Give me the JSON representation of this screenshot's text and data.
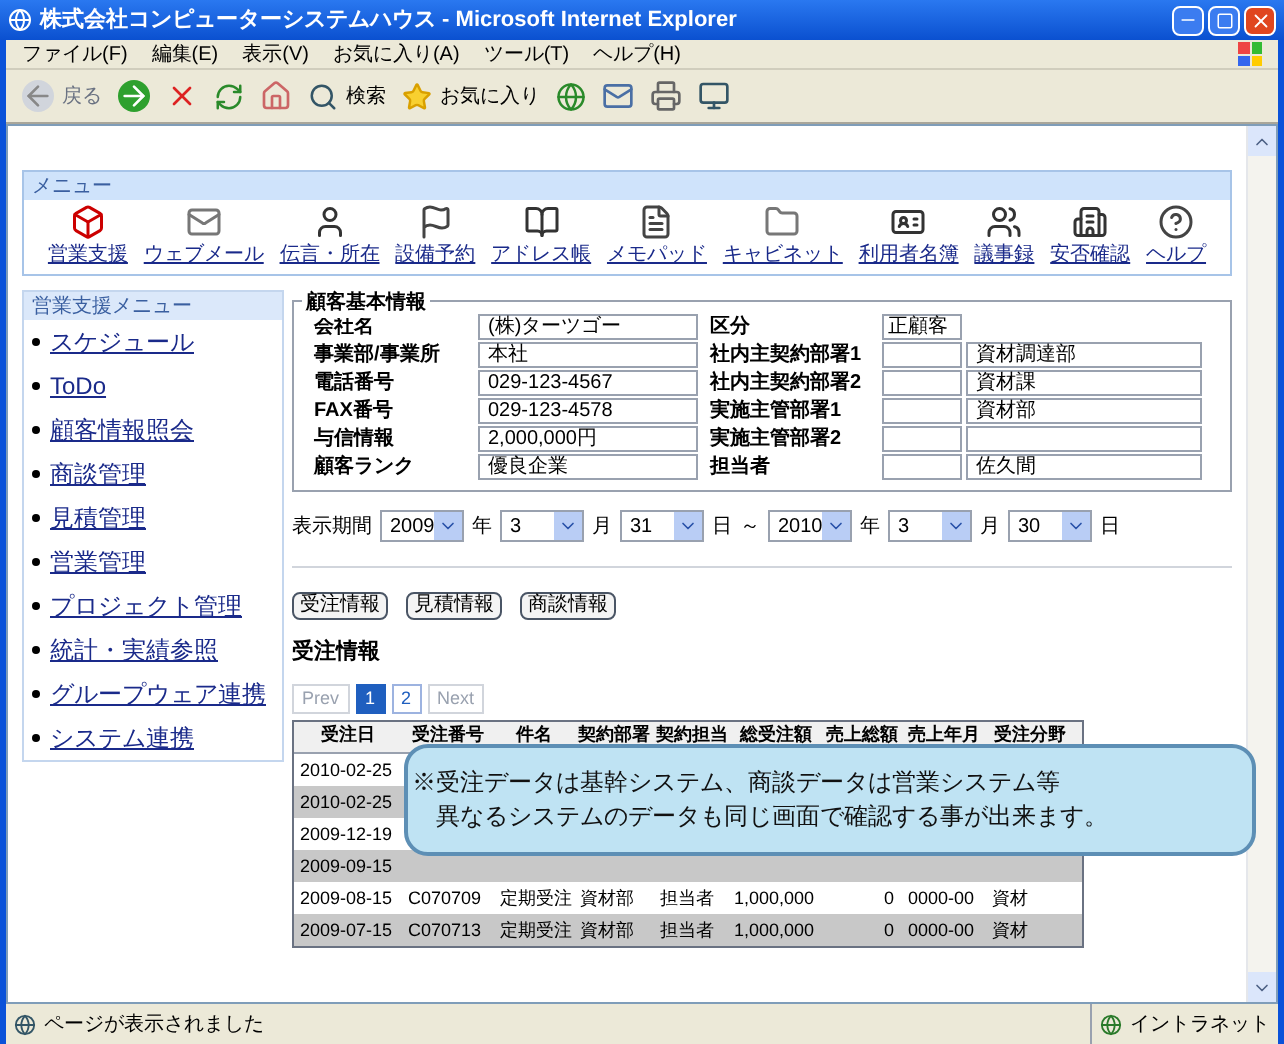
{
  "window": {
    "title": "株式会社コンピューターシステムハウス - Microsoft Internet Explorer"
  },
  "menu_bar": [
    "ファイル(F)",
    "編集(E)",
    "表示(V)",
    "お気に入り(A)",
    "ツール(T)",
    "ヘルプ(H)"
  ],
  "toolbar": {
    "back": "戻る",
    "search": "検索",
    "favorites": "お気に入り"
  },
  "app_menu": {
    "title": "メニュー",
    "items": [
      "営業支援",
      "ウェブメール",
      "伝言・所在",
      "設備予約",
      "アドレス帳",
      "メモパッド",
      "キャビネット",
      "利用者名簿",
      "議事録",
      "安否確認",
      "ヘルプ"
    ]
  },
  "sidebar": {
    "title": "営業支援メニュー",
    "items": [
      "スケジュール",
      "ToDo",
      "顧客情報照会",
      "商談管理",
      "見積管理",
      "営業管理",
      "プロジェクト管理",
      "統計・実績参照",
      "グループウェア連携",
      "システム連携"
    ]
  },
  "customer": {
    "title": "顧客基本情報",
    "rows": [
      {
        "label": "会社名",
        "value": "(株)ターツゴー",
        "label_2": "区分",
        "code": "正顧客"
      },
      {
        "label": "事業部/事業所",
        "value": "本社",
        "label_2": "社内主契約部署1",
        "value_2": "資材調達部"
      },
      {
        "label": "電話番号",
        "value": "029-123-4567",
        "label_2": "社内主契約部署2",
        "value_2": "資材課"
      },
      {
        "label": "FAX番号",
        "value": "029-123-4578",
        "label_2": "実施主管部署1",
        "value_2": "資材部"
      },
      {
        "label": "与信情報",
        "value": "2,000,000円",
        "label_2": "実施主管部署2"
      },
      {
        "label": "顧客ランク",
        "value": "優良企業",
        "label_2": "担当者",
        "value_2": "佐久間"
      }
    ]
  },
  "period": {
    "label": "表示期間",
    "separator": "～",
    "parts": [
      {
        "value": "2009",
        "unit": "年"
      },
      {
        "value": "3",
        "unit": "月"
      },
      {
        "value": "31",
        "unit": "日"
      },
      {
        "value": "2010",
        "unit": "年"
      },
      {
        "value": "3",
        "unit": "月"
      },
      {
        "value": "30",
        "unit": "日"
      }
    ]
  },
  "tab_buttons": [
    "受注情報",
    "見積情報",
    "商談情報"
  ],
  "section_title": "受注情報",
  "pagination": [
    {
      "label": "Prev",
      "kind": "nav",
      "selected": false
    },
    {
      "label": "1",
      "kind": "page",
      "selected": true
    },
    {
      "label": "2",
      "kind": "page",
      "selected": false
    },
    {
      "label": "Next",
      "kind": "nav",
      "selected": false
    }
  ],
  "table": {
    "columns": [
      "受注日",
      "受注番号",
      "件名",
      "契約部署",
      "契約担当",
      "総受注額",
      "売上総額",
      "売上年月",
      "受注分野"
    ],
    "rows": [
      {
        "cells": [
          "2010-02-25"
        ]
      },
      {
        "cells": [
          "2010-02-25"
        ]
      },
      {
        "cells": [
          "2009-12-19"
        ]
      },
      {
        "cells": [
          "2009-09-15"
        ]
      },
      {
        "cells": [
          "2009-08-15",
          "C070709",
          "定期受注",
          "資材部",
          "担当者",
          "1,000,000",
          "0",
          "0000-00",
          "資材"
        ]
      },
      {
        "cells": [
          "2009-07-15",
          "C070713",
          "定期受注",
          "資材部",
          "担当者",
          "1,000,000",
          "0",
          "0000-00",
          "資材"
        ]
      }
    ]
  },
  "callout": [
    "※受注データは基幹システム、商談データは営業システム等",
    "異なるシステムのデータも同じ画面で確認する事が出来ます。"
  ],
  "status_bar": {
    "message": "ページが表示されました",
    "zone": "イントラネット"
  }
}
